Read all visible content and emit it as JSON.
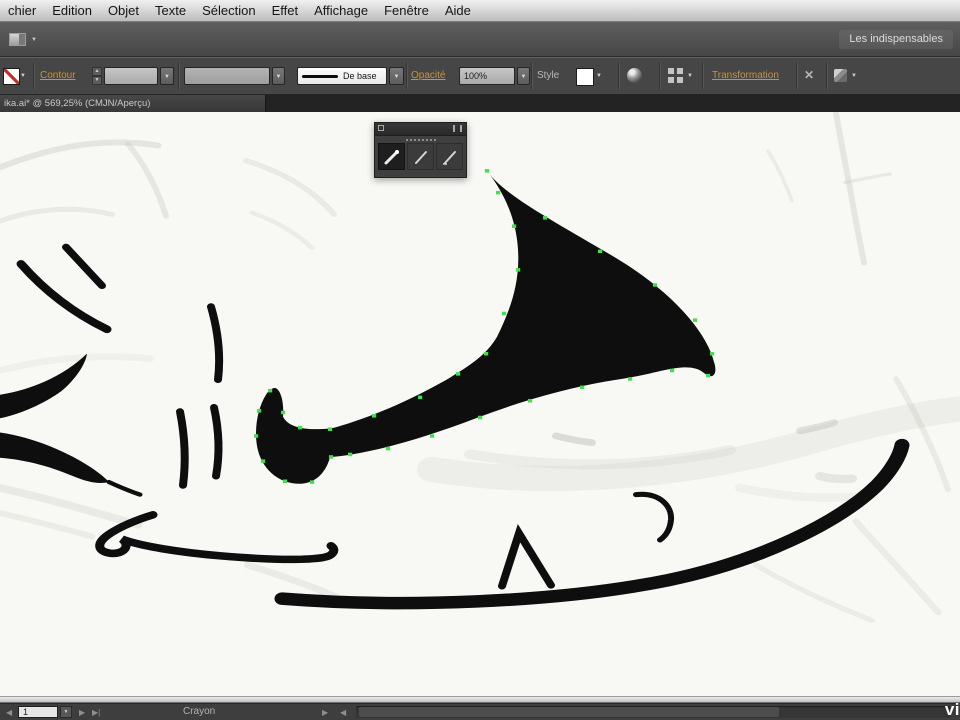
{
  "menu_bar": {
    "items": [
      "chier",
      "Edition",
      "Objet",
      "Texte",
      "Sélection",
      "Effet",
      "Affichage",
      "Fenêtre",
      "Aide"
    ]
  },
  "app_bar": {
    "workspace_button": "Les indispensables"
  },
  "control_bar": {
    "stroke_link": "Contour",
    "stroke_weight_value": "",
    "brush_definition_value": "",
    "profile_value": "De base",
    "opacity_link": "Opacité",
    "opacity_value": "100%",
    "style_label": "Style",
    "transform_link": "Transformation"
  },
  "document_tab": {
    "title": "ika.ai* @ 569,25% (CMJN/Aperçu)"
  },
  "pencil_palette": {
    "tools": [
      "pencil-tool",
      "smooth-tool",
      "path-eraser-tool"
    ],
    "selected": "pencil-tool"
  },
  "status_bar": {
    "artboard_field_value": "1",
    "tool_status": "Crayon"
  },
  "watermark": {
    "text": "vi"
  },
  "icons": {
    "dropdown_arrow": "▼",
    "up_arrow": "▲",
    "down_arrow": "▼",
    "prev_arrow": "◀",
    "next_arrow": "▶",
    "last_arrow": "▶|",
    "close_x": "✕"
  },
  "colors": {
    "link_orange": "#c9943a",
    "anchor_green": "#42df4f",
    "ink_black": "#0e0e0e",
    "canvas": "#f8f8f5"
  }
}
